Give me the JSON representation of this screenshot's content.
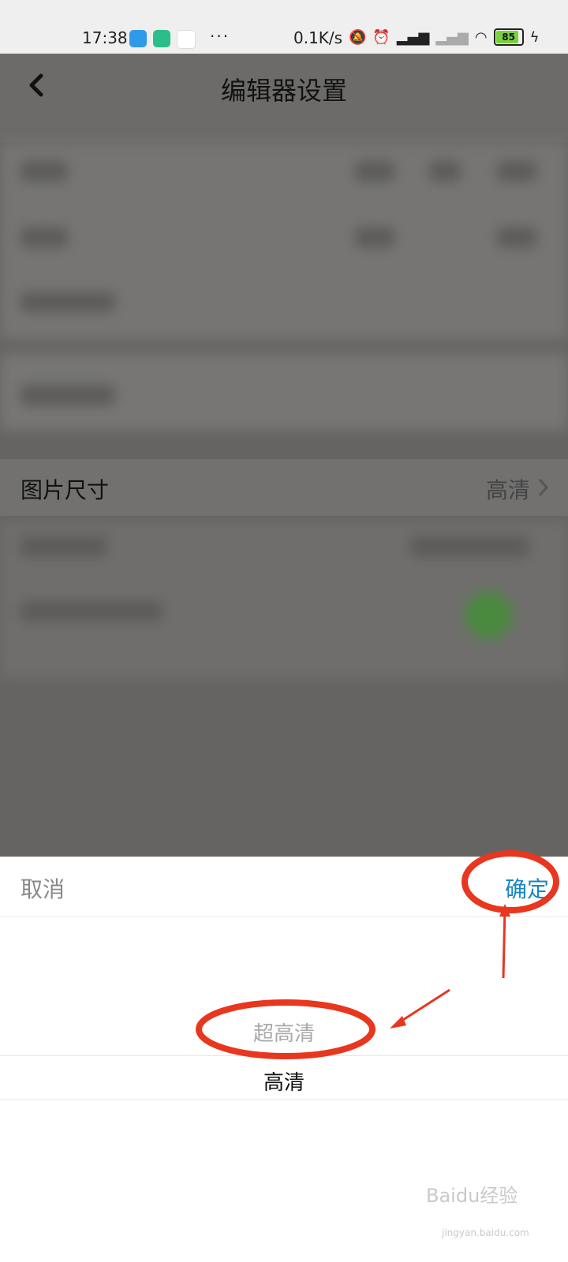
{
  "status_bar": {
    "time": "17:38",
    "net_speed": "0.1K/s",
    "battery": "85",
    "more": "···"
  },
  "header": {
    "title": "编辑器设置"
  },
  "settings": {
    "image_size_label": "图片尺寸",
    "image_size_value": "高清"
  },
  "sheet": {
    "cancel_label": "取消",
    "confirm_label": "确定",
    "options": [
      "超高清",
      "高清"
    ],
    "selected": "高清"
  },
  "watermark": {
    "brand": "Baidu经验",
    "url": "jingyan.baidu.com"
  },
  "colors": {
    "confirm": "#1a86c4",
    "annotation": "#e8361f"
  }
}
